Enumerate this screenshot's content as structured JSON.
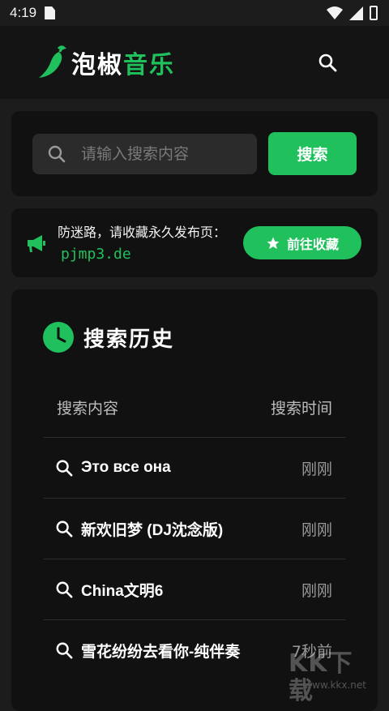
{
  "status_bar": {
    "time": "4:19"
  },
  "app": {
    "brand_white": "泡椒",
    "brand_green": "音乐",
    "accent": "#20c05c"
  },
  "search": {
    "placeholder": "请输入搜索内容",
    "value": "",
    "button_label": "搜索"
  },
  "notice": {
    "text": "防迷路，请收藏永久发布页：",
    "url": "pjmp3.de",
    "button_label": "前往收藏"
  },
  "history": {
    "title": "搜索历史",
    "col_query": "搜索内容",
    "col_time": "搜索时间",
    "rows": [
      {
        "query": "Это все она",
        "time": "刚刚"
      },
      {
        "query": "新欢旧梦 (DJ沈念版)",
        "time": "刚刚"
      },
      {
        "query": "China文明6",
        "time": "刚刚"
      },
      {
        "query": "雪花纷纷去看你-纯伴奏",
        "time": "7秒前"
      }
    ]
  },
  "watermark": {
    "big": "KK下载",
    "small": "www.kkx.net"
  }
}
